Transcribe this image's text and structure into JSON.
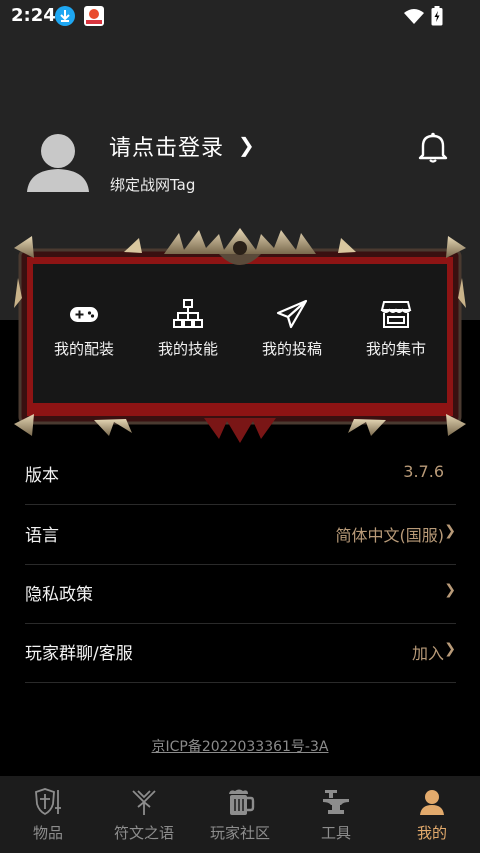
{
  "status_bar": {
    "time": "2:24"
  },
  "profile": {
    "login_prompt": "请点击登录",
    "login_chevron": "❯",
    "bind_hint": "绑定战网Tag"
  },
  "quick_menu": [
    {
      "label": "我的配装",
      "icon": "gamepad-icon"
    },
    {
      "label": "我的技能",
      "icon": "skill-tree-icon"
    },
    {
      "label": "我的投稿",
      "icon": "paper-plane-icon"
    },
    {
      "label": "我的集市",
      "icon": "market-stall-icon"
    }
  ],
  "settings": [
    {
      "label": "版本",
      "value": "3.7.6",
      "chevron": ""
    },
    {
      "label": "语言",
      "value": "简体中文(国服)",
      "chevron": "❯"
    },
    {
      "label": "隐私政策",
      "value": "",
      "chevron": "❯"
    },
    {
      "label": "玩家群聊/客服",
      "value": "加入",
      "chevron": "❯"
    }
  ],
  "icp": "京ICP备2022033361号-3A",
  "tabs": [
    {
      "label": "物品",
      "icon": "shield-sword-icon",
      "active": false
    },
    {
      "label": "符文之语",
      "icon": "rune-icon",
      "active": false
    },
    {
      "label": "玩家社区",
      "icon": "beer-mug-icon",
      "active": false
    },
    {
      "label": "工具",
      "icon": "anvil-icon",
      "active": false
    },
    {
      "label": "我的",
      "icon": "user-icon",
      "active": true
    }
  ],
  "colors": {
    "accent": "#e2aa6c",
    "value_text": "#b89a78",
    "frame_red": "#8e1414"
  }
}
